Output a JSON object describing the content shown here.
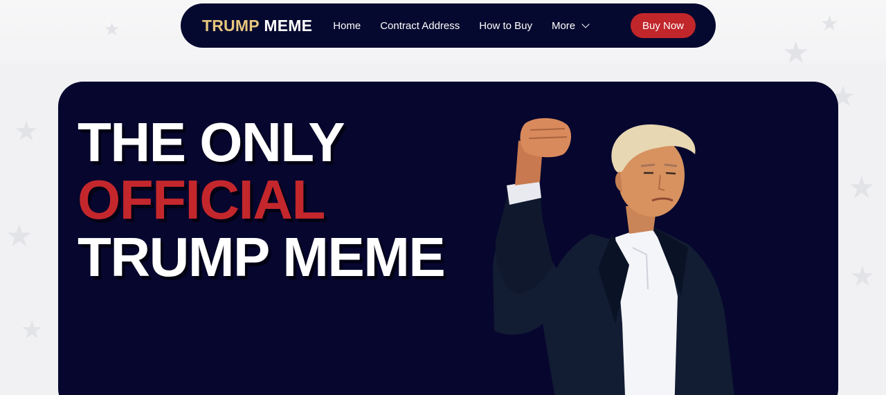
{
  "nav": {
    "logo_part1": "TRUMP",
    "logo_part2": "MEME",
    "links": [
      "Home",
      "Contract Address",
      "How to Buy"
    ],
    "more_label": "More",
    "buy_label": "Buy Now"
  },
  "hero": {
    "line1": "THE ONLY",
    "line2": "OFFICIAL",
    "line3": "TRUMP MEME",
    "image_icon": "trump-fist-raised-portrait"
  },
  "colors": {
    "navy": "#06092f",
    "red": "#c1262b",
    "gold": "#e7c77e",
    "background": "#f1f1f3"
  }
}
